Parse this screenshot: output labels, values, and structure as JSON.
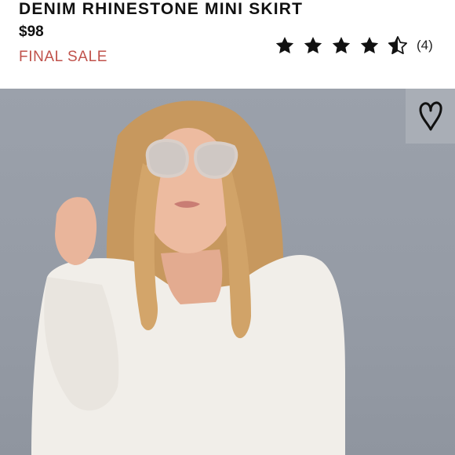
{
  "product": {
    "title": "DENIM RHINESTONE MINI SKIRT",
    "price": "$98",
    "sale_label": "FINAL SALE"
  },
  "rating": {
    "stars": 4.5,
    "max": 5,
    "count": "(4)"
  },
  "photo": {
    "description_icon": "model-photo",
    "background_color": "#979da7",
    "favorite_icon": "heart-icon"
  },
  "colors": {
    "sale": "#c0524b",
    "text": "#111111"
  }
}
